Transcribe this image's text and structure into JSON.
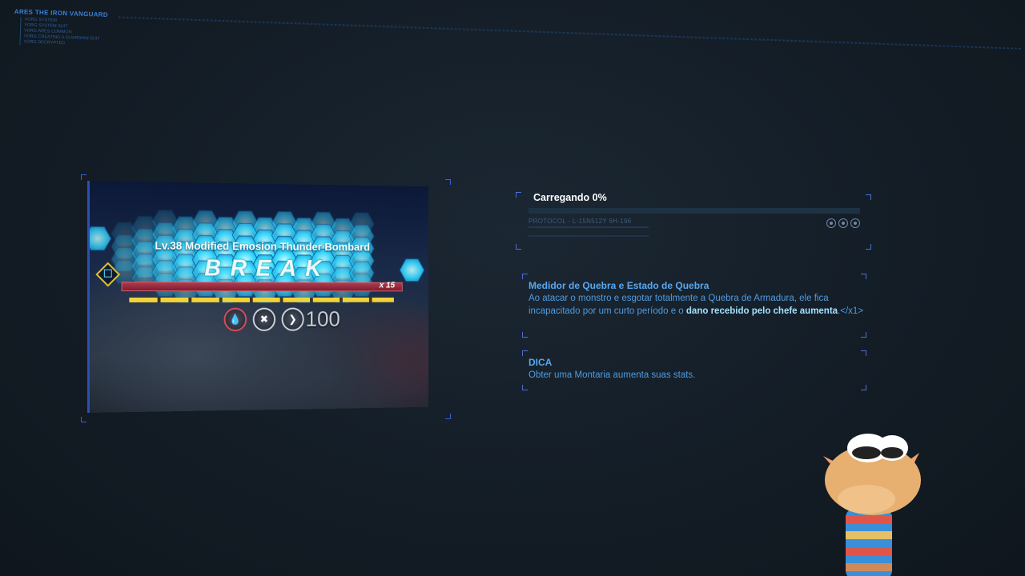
{
  "system": {
    "title": "ARES THE IRON VANGUARD",
    "lines": [
      "VORG SYSTEM",
      "VORG SYSTEM SUIT",
      "VORG ARES COMMON",
      "VORG CREATING A GUARDIAN SUIT",
      "VORG DECRYPTED"
    ]
  },
  "preview": {
    "boss_name": "Lv.38 Modified Emosion Thunder Bombard",
    "break_label": "BREAK",
    "multiplier": "x 15",
    "resistance_value": "100",
    "icons": [
      "water-shield-icon",
      "crossed-swords-icon",
      "break-shield-icon"
    ]
  },
  "loading": {
    "label": "Carregando 0%",
    "progress": 0,
    "protocol": "PROTOCOL - L-15N512Y 6H-196"
  },
  "info": {
    "title": "Medidor de Quebra e Estado de Quebra",
    "body_prefix": "Ao atacar o monstro e esgotar totalmente a Quebra de Armadura, ele fica incapacitado por um curto período e o ",
    "body_highlight": "dano recebido pelo chefe aumenta",
    "body_suffix": ".</x1>"
  },
  "tip": {
    "title": "DICA",
    "body": "Obter uma Montaria aumenta suas stats."
  },
  "colors": {
    "accent": "#58a8f2",
    "highlight": "#a3e0ff",
    "bracket": "#4d6fd6",
    "hp_red": "#b23a4e",
    "break_yellow": "#f3d33a"
  }
}
